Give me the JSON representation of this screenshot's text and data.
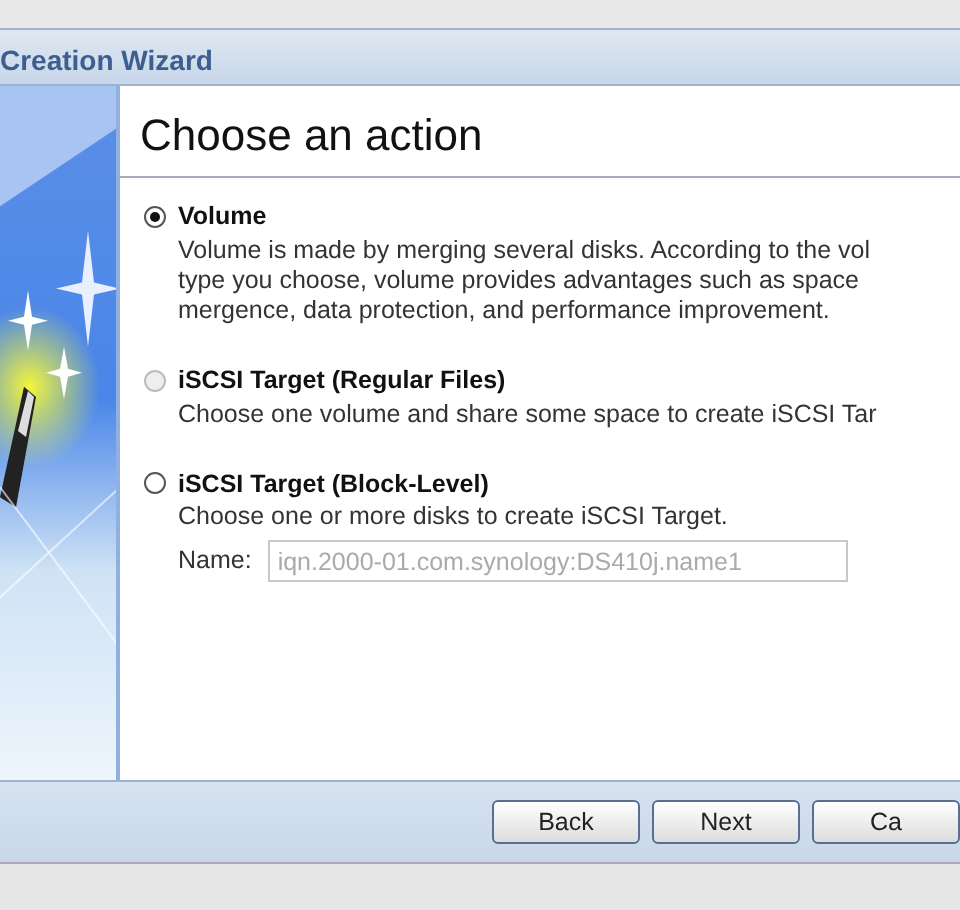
{
  "window": {
    "title": "Creation Wizard"
  },
  "heading": "Choose an action",
  "options": [
    {
      "label": "Volume",
      "selected": true,
      "disabled": false,
      "description": [
        "Volume is made by merging several disks. According to the vol",
        "type you choose, volume provides advantages such as space",
        "mergence, data protection, and performance improvement."
      ]
    },
    {
      "label": "iSCSI Target (Regular Files)",
      "selected": false,
      "disabled": true,
      "description": [
        "Choose one volume and share some space to create iSCSI Tar"
      ]
    },
    {
      "label": "iSCSI Target (Block-Level)",
      "selected": false,
      "disabled": false,
      "description": [
        "Choose one or more disks to create iSCSI Target."
      ],
      "name_field": {
        "label": "Name:",
        "value": "iqn.2000-01.com.synology:DS410j.name1",
        "disabled": true
      }
    }
  ],
  "buttons": [
    "Back",
    "Next",
    "Ca"
  ]
}
